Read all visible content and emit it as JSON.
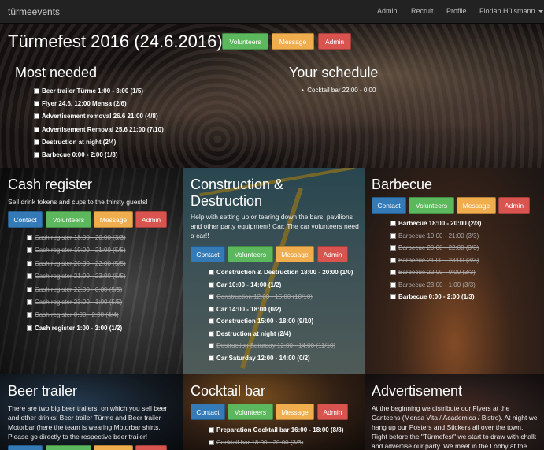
{
  "nav": {
    "brand": "türmeevents",
    "links": [
      "Admin",
      "Recruit",
      "Profile"
    ],
    "user": "Florian Hülsmann"
  },
  "event": {
    "title": "Türmefest 2016 (24.6.2016)",
    "buttons": {
      "volunteers": "Volunteers",
      "message": "Message",
      "admin": "Admin"
    }
  },
  "most_needed": {
    "heading": "Most needed",
    "items": [
      "Beer trailer Türme 1:00 - 3:00 (1/5)",
      "Flyer 24.6. 12:00 Mensa (2/6)",
      "Advertisement removal 26.6 21:00 (4/8)",
      "Advertisement Removal 25.6 21:00 (7/10)",
      "Destruction at night (2/4)",
      "Barbecue 0:00 - 2:00 (1/3)"
    ]
  },
  "schedule": {
    "heading": "Your schedule",
    "items": [
      "Cocktail bar 22:00 - 0:00"
    ]
  },
  "buttons": {
    "contact": "Contact",
    "volunteers": "Volunteers",
    "message": "Message",
    "admin": "Admin"
  },
  "teams": {
    "cash": {
      "title": "Cash register",
      "desc": "Sell drink tokens and cups to the thirsty guests!",
      "slots": [
        {
          "label": "Cash register 18:00 - 20:00 (3/3)",
          "full": true
        },
        {
          "label": "Cash register 19:00 - 21:00 (5/5)",
          "full": true
        },
        {
          "label": "Cash register 20:00 - 22:00 (5/5)",
          "full": true
        },
        {
          "label": "Cash register 21:00 - 23:00 (5/5)",
          "full": true
        },
        {
          "label": "Cash register 22:00 - 0:00 (5/5)",
          "full": true
        },
        {
          "label": "Cash register 23:00 - 1:00 (5/5)",
          "full": true
        },
        {
          "label": "Cash register 0:00 - 2:00 (4/4)",
          "full": true
        },
        {
          "label": "Cash register 1:00 - 3:00 (1/2)",
          "full": false
        }
      ]
    },
    "construction": {
      "title_line1": "Construction &",
      "title_line2": "Destruction",
      "desc": "Help with setting up or tearing down the bars, pavilions and other party equipment! Car: The car volunteers need a car!!",
      "slots": [
        {
          "label": "Construction & Destruction 18:00 - 20:00 (1/0)",
          "full": false
        },
        {
          "label": "Car 10:00 - 14:00 (1/2)",
          "full": false
        },
        {
          "label": "Construction 12:00 - 15:00 (10/10)",
          "full": true
        },
        {
          "label": "Car 14:00 - 18:00 (0/2)",
          "full": false
        },
        {
          "label": "Construction 15:00 - 18:00 (9/10)",
          "full": false
        },
        {
          "label": "Destruction at night (2/4)",
          "full": false
        },
        {
          "label": "Destruction Saturday 12:00 - 14:00 (11/10)",
          "full": true
        },
        {
          "label": "Car Saturday 12:00 - 14:00 (0/2)",
          "full": false
        }
      ]
    },
    "barbecue": {
      "title": "Barbecue",
      "slots": [
        {
          "label": "Barbecue 18:00 - 20:00 (2/3)",
          "full": false
        },
        {
          "label": "Barbecue 19:00 - 21:00 (3/3)",
          "full": true
        },
        {
          "label": "Barbecue 20:00 - 22:00 (3/3)",
          "full": true
        },
        {
          "label": "Barbecue 21:00 - 23:00 (3/3)",
          "full": true
        },
        {
          "label": "Barbecue 22:00 - 0:00 (3/3)",
          "full": true
        },
        {
          "label": "Barbecue 23:00 - 1:00 (3/3)",
          "full": true
        },
        {
          "label": "Barbecue 0:00 - 2:00 (1/3)",
          "full": false
        }
      ]
    },
    "beer": {
      "title": "Beer trailer",
      "desc": "There are two big beer trailers, on which you sell beer and other drinks: Beer trailer Türme and Beer trailer Motorbar (here the team is wearing Motorbar shirts. Please go directly to the respective beer trailer!"
    },
    "cocktail": {
      "title": "Cocktail bar",
      "slots": [
        {
          "label": "Preparation Cocktail bar 16:00 - 18:00 (8/8)",
          "full": false
        },
        {
          "label": "Cocktail bar 18:00 - 20:00 (3/3)",
          "full": true
        }
      ]
    },
    "advertisement": {
      "title": "Advertisement",
      "desc": "At the beginning we distribute our Flyers at the Canteens (Mensa Vita / Academica / Bistro). At night we hang up our Posters and Stickers all over the town. Right before the \"Türmefest\" we start to draw with chalk and advertise our party. We meet in the Lobby at the"
    }
  },
  "colors": {
    "primary": "#337ab7",
    "success": "#5cb85c",
    "warning": "#f0ad4e",
    "danger": "#d9534f",
    "navbar": "#222222"
  }
}
